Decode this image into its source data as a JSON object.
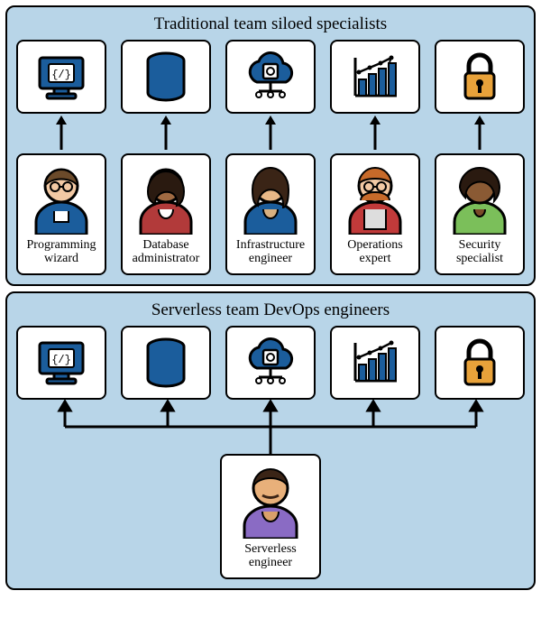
{
  "top_panel": {
    "title": "Traditional team siloed specialists",
    "icons": [
      "code-monitor",
      "database",
      "cloud-chip",
      "bar-chart",
      "padlock"
    ],
    "people": [
      {
        "label": "Programming wizard"
      },
      {
        "label": "Database administrator"
      },
      {
        "label": "Infrastructure engineer"
      },
      {
        "label": "Operations expert"
      },
      {
        "label": "Security specialist"
      }
    ]
  },
  "bottom_panel": {
    "title": "Serverless team DevOps engineers",
    "icons": [
      "code-monitor",
      "database",
      "cloud-chip",
      "bar-chart",
      "padlock"
    ],
    "person": {
      "label": "Serverless engineer"
    }
  }
}
